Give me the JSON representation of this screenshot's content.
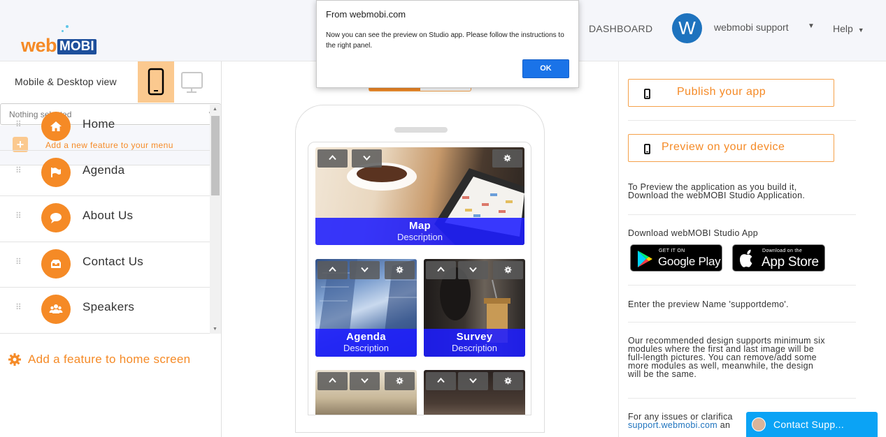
{
  "header": {
    "logo_web": "web",
    "logo_mobi": "MOBI",
    "dashboard": "DASHBOARD",
    "avatar_letter": "W",
    "user_name": "webmobi support",
    "help": "Help"
  },
  "left": {
    "view_label": "Mobile & Desktop view",
    "select_value": "Nothing selected",
    "add_menu_label": "Add a new feature to your menu",
    "menu_items": [
      {
        "label": "Home",
        "icon": "home-icon"
      },
      {
        "label": "Agenda",
        "icon": "flag-icon"
      },
      {
        "label": "About Us",
        "icon": "chat-bubble-icon"
      },
      {
        "label": "Contact Us",
        "icon": "inbox-icon"
      },
      {
        "label": "Speakers",
        "icon": "users-icon"
      }
    ],
    "add_home_label": "Add a feature to home screen"
  },
  "phone": {
    "tiles": [
      {
        "title": "Map",
        "desc": "Description"
      },
      {
        "title": "Agenda",
        "desc": "Description"
      },
      {
        "title": "Survey",
        "desc": "Description"
      }
    ]
  },
  "right": {
    "publish_label": "Publish your app",
    "preview_label": "Preview on your device",
    "preview_info_1": "To Preview the application as you build it,",
    "preview_info_2": "Download the webMOBI Studio Application.",
    "download_title": "Download webMOBI Studio App",
    "google_small": "GET IT ON",
    "google_big": "Google Play",
    "apple_small": "Download on the",
    "apple_big": "App Store",
    "preview_name": "Enter the preview Name 'supportdemo'.",
    "design_1": "Our recommended design supports minimum six",
    "design_2": "modules where the first and last image will be",
    "design_3": "full-length pictures. You can remove/add some",
    "design_4": "more modules as well, meanwhile, the design",
    "design_5": "will be the same.",
    "issues_1": "For any issues or clarifica",
    "issues_link": "support.webmobi.com",
    "issues_2": " an"
  },
  "alert": {
    "title": "From webmobi.com",
    "message": "Now you can see the preview on Studio app. Please follow the instructions to the right panel.",
    "ok": "OK"
  },
  "chat": {
    "label": "Contact Supp..."
  },
  "colors": {
    "accent": "#f58a26",
    "accent_light": "#fbc98f",
    "brand_blue": "#1d4f9c",
    "caption_blue": "#1e1eff",
    "chat_blue": "#0ba3f5"
  }
}
